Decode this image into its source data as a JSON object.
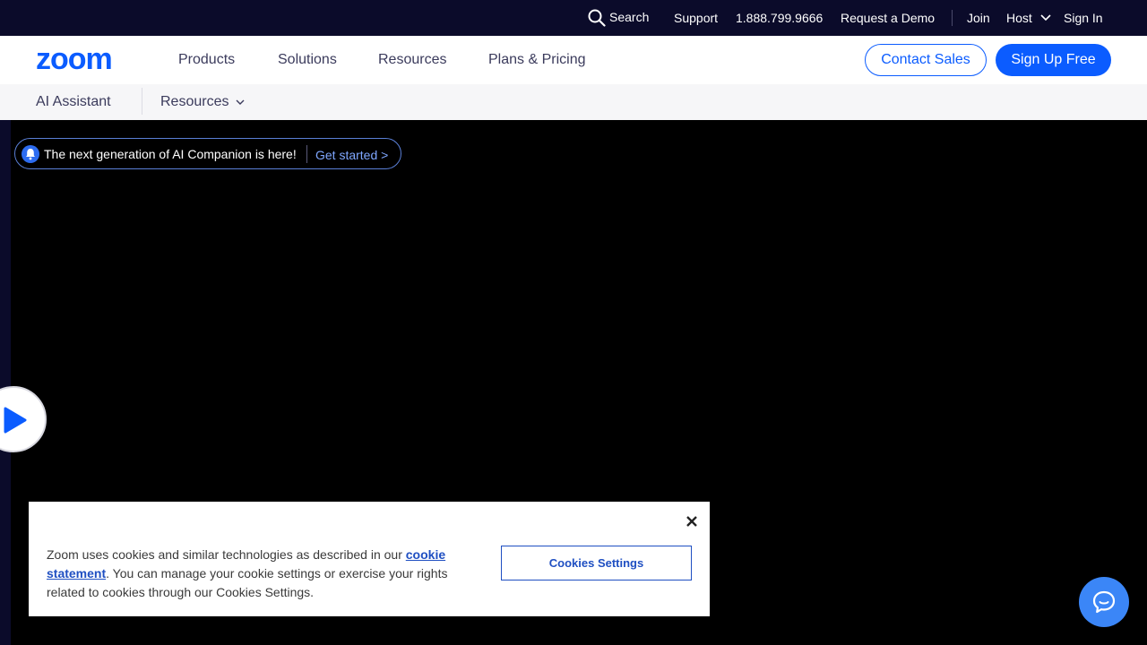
{
  "utility": {
    "search": "Search",
    "support": "Support",
    "phone": "1.888.799.9666",
    "request_demo": "Request a Demo",
    "join": "Join",
    "host": "Host",
    "sign_in": "Sign In"
  },
  "nav": {
    "logo": "zoom",
    "products": "Products",
    "solutions": "Solutions",
    "resources": "Resources",
    "plans_pricing": "Plans & Pricing",
    "contact_sales": "Contact Sales",
    "sign_up": "Sign Up Free"
  },
  "subnav": {
    "ai_assistant": "AI Assistant",
    "resources": "Resources"
  },
  "announcement": {
    "message": "The next generation of AI Companion is here!",
    "cta": "Get started >"
  },
  "cookie": {
    "text_before": "Zoom uses cookies and similar technologies as described in our ",
    "link": "cookie statement",
    "text_after": ". You can manage your cookie settings or exercise your rights related to cookies through our Cookies Settings.",
    "settings_button": "Cookies Settings"
  },
  "colors": {
    "brand_blue": "#0b5cff",
    "utility_bg": "#0b0b2a",
    "chat_blue": "#3b86f7"
  }
}
